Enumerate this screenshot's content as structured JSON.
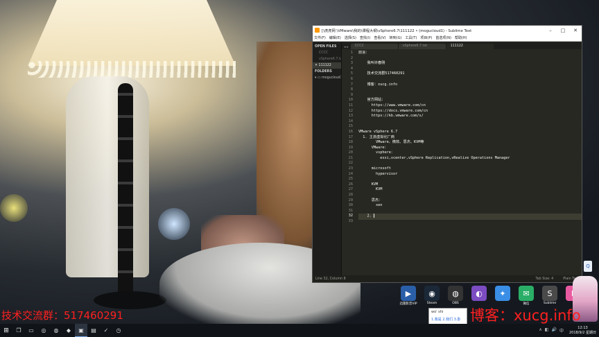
{
  "window": {
    "title": "[\\虎虎网 \\VMware\\我的\\课程大纲\\vSphere6.7\\111122 • (mogucloud1) - Sublime Text",
    "controls": {
      "minimize": "–",
      "maximize": "□",
      "close": "✕"
    }
  },
  "menu": [
    "文件(F)",
    "编辑(E)",
    "选择(S)",
    "查找(I)",
    "查看(V)",
    "转到(G)",
    "工具(T)",
    "项目(P)",
    "首选项(N)",
    "帮助(H)"
  ],
  "sidebar": {
    "open_files_header": "OPEN FILES",
    "open_files": [
      {
        "name": "CCCC",
        "active": false
      },
      {
        "name": "vSphere6.7.txt",
        "active": false
      },
      {
        "name": "111122",
        "active": true
      }
    ],
    "folders_header": "FOLDERS",
    "folders": [
      "mogucloud1"
    ]
  },
  "tabs": {
    "nav": "◂ ▸",
    "items": [
      {
        "label": "CCCC",
        "active": false
      },
      {
        "label": "vSphere6.7.txt",
        "active": false
      },
      {
        "label": "111122",
        "active": true
      }
    ]
  },
  "editor": {
    "current_line": 32,
    "lines": [
      "前言：",
      "",
      "    我叫许春刚",
      "",
      "    技术交流群517460291",
      "",
      "    博客：xucg.info",
      "",
      "",
      "    官方网站：",
      "      https://www.vmware.com/cn",
      "      https://docs.vmware.com/cn",
      "      https://kb.vmware.com/s/",
      "",
      "",
      "VMware vSphere 6.7",
      "  1. 主流虚拟化厂商",
      "        VMware、微软、思杰、KVM等",
      "      VMware：",
      "        vsphere：",
      "          esxi,vcenter,vSphere Replication,vRealize Operations Manager",
      "",
      "      microsoft",
      "        hypervisor",
      "",
      "      KVM",
      "        KVM",
      "",
      "      思杰：",
      "        xen",
      "",
      "    2. ",
      ""
    ]
  },
  "statusbar": {
    "left": "Line 32, Column 8",
    "tab_size": "Tab Size: 4",
    "syntax": "Plain Text"
  },
  "desktop_icons": [
    {
      "label": "迅雷影音VIP",
      "icon": "thunder-icon",
      "color": "#2a5fa8",
      "glyph": "▶"
    },
    {
      "label": "Steam",
      "icon": "steam-icon",
      "color": "#1b2838",
      "glyph": "◉"
    },
    {
      "label": "OBS",
      "icon": "obs-icon",
      "color": "#333333",
      "glyph": "◍"
    },
    {
      "label": "",
      "icon": "player-icon",
      "color": "#7c4cc2",
      "glyph": "◐"
    },
    {
      "label": "",
      "icon": "qq-icon",
      "color": "#3a8ee6",
      "glyph": "✦"
    },
    {
      "label": "微信",
      "icon": "wechat-icon",
      "color": "#2aae67",
      "glyph": "✉"
    },
    {
      "label": "Sublime",
      "icon": "sublime-icon",
      "color": "#4a4a4a",
      "glyph": "S"
    },
    {
      "label": "",
      "icon": "lilei-icon",
      "color": "#e85aa0",
      "glyph": "L"
    }
  ],
  "overlays": {
    "left_text": "技术交流群：517460291",
    "right_text": "博客：xucg.info",
    "color": "#ff2020"
  },
  "ime": {
    "composition": "wo' shi",
    "candidates": "1.我是  2.我们  3.卧"
  },
  "taskbar": {
    "items": [
      {
        "name": "start",
        "glyph": "⊞",
        "icon": "windows-icon"
      },
      {
        "name": "task-view",
        "glyph": "❐",
        "icon": "task-view-icon"
      },
      {
        "name": "explorer",
        "glyph": "▭",
        "icon": "folder-icon"
      },
      {
        "name": "chrome",
        "glyph": "◎",
        "icon": "chrome-icon"
      },
      {
        "name": "firefox",
        "glyph": "◍",
        "icon": "firefox-icon"
      },
      {
        "name": "app-red",
        "glyph": "◆",
        "icon": "app-icon"
      },
      {
        "name": "app-window",
        "glyph": "▣",
        "icon": "window-icon"
      },
      {
        "name": "app-box",
        "glyph": "▤",
        "icon": "box-icon"
      },
      {
        "name": "app-check",
        "glyph": "✓",
        "icon": "check-icon"
      },
      {
        "name": "app-clock",
        "glyph": "◷",
        "icon": "clock-app-icon"
      }
    ],
    "tray": [
      "∧",
      "◧",
      "🔊",
      "中"
    ],
    "time": "12:13",
    "date": "2018/9/2 星期日"
  }
}
